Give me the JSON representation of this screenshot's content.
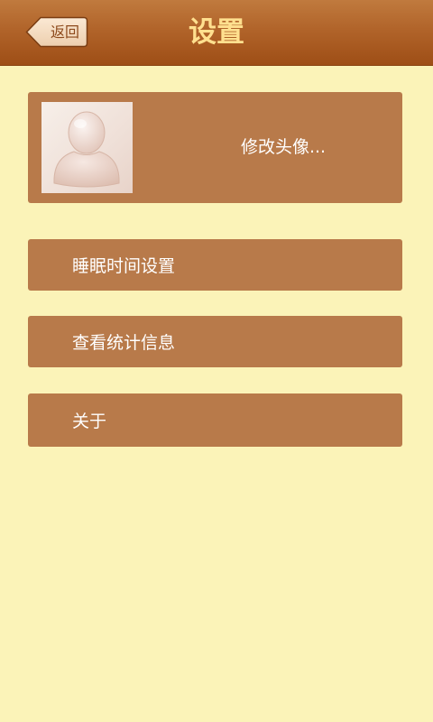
{
  "header": {
    "back_label": "返回",
    "title": "设置",
    "back_icon": "back-arrow-icon"
  },
  "profile": {
    "avatar_icon": "default-user-avatar-icon",
    "change_avatar_label": "修改头像..."
  },
  "menu": {
    "items": [
      {
        "label": "睡眠时间设置"
      },
      {
        "label": "查看统计信息"
      },
      {
        "label": "关于"
      }
    ]
  },
  "colors": {
    "background": "#fbf3b8",
    "header_top": "#c07a3e",
    "header_bottom": "#9e4e16",
    "title_text": "#ffe08f",
    "card": "#b87a4a",
    "card_text": "#ffffff"
  }
}
